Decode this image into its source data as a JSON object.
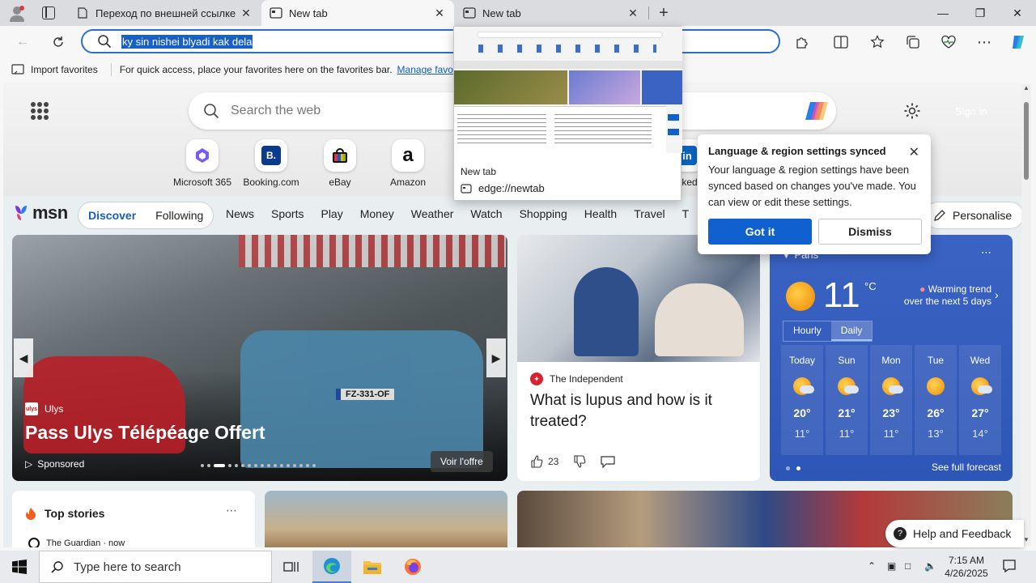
{
  "tabs": [
    {
      "title": "Переход по внешней ссылке",
      "active": false
    },
    {
      "title": "New tab",
      "active": true
    },
    {
      "title": "New tab",
      "active": false
    }
  ],
  "address_bar": {
    "text": "ky sin nishei blyadi kak dela"
  },
  "favorites_bar": {
    "import_label": "Import favorites",
    "hint": "For quick access, place your favorites here on the favorites bar.",
    "manage_link": "Manage favorites"
  },
  "newtab": {
    "search_placeholder": "Search the web",
    "sign_in": "Sign in",
    "quick_links": [
      {
        "label": "Microsoft 365",
        "icon": "microsoft-365-icon"
      },
      {
        "label": "Booking.com",
        "icon": "booking-icon",
        "glyph": "B."
      },
      {
        "label": "eBay",
        "icon": "ebay-icon"
      },
      {
        "label": "Amazon",
        "icon": "amazon-icon",
        "glyph": "a"
      },
      {
        "label": "LinkedIn",
        "icon": "linkedin-icon",
        "glyph": "in"
      }
    ]
  },
  "msn": {
    "logo": "msn",
    "feed_tabs": [
      "Discover",
      "Following"
    ],
    "nav": [
      "News",
      "Sports",
      "Play",
      "Money",
      "Weather",
      "Watch",
      "Shopping",
      "Health",
      "Travel",
      "T"
    ],
    "personalise": "Personalise"
  },
  "carousel": {
    "source": "Ulys",
    "title": "Pass Ulys Télépéage Offert",
    "sponsored": "Sponsored",
    "cta": "Voir l'offre",
    "plate": "FZ-331-OF"
  },
  "news_card": {
    "source": "The Independent",
    "title": "What is lupus and how is it treated?",
    "likes": "23"
  },
  "weather": {
    "location": "Paris",
    "temp": "11",
    "unit": "°C",
    "trend_line1": "Warming trend",
    "trend_line2": "over the next 5 days",
    "toggle": [
      "Hourly",
      "Daily"
    ],
    "days": [
      {
        "d": "Today",
        "hi": "20°",
        "lo": "11°",
        "icon": "partly-cloudy"
      },
      {
        "d": "Sun",
        "hi": "21°",
        "lo": "11°",
        "icon": "partly-cloudy"
      },
      {
        "d": "Mon",
        "hi": "23°",
        "lo": "11°",
        "icon": "partly-cloudy"
      },
      {
        "d": "Tue",
        "hi": "26°",
        "lo": "13°",
        "icon": "sunny"
      },
      {
        "d": "Wed",
        "hi": "27°",
        "lo": "14°",
        "icon": "partly-cloudy"
      }
    ],
    "see_full": "See full forecast"
  },
  "top_stories": {
    "title": "Top stories",
    "source": "The Guardian · now"
  },
  "help_feedback": "Help and Feedback",
  "tab_preview": {
    "title": "New tab",
    "url": "edge://newtab"
  },
  "lang_popup": {
    "title": "Language & region settings synced",
    "body": "Your language & region settings have been synced based on changes you've made. You can view or edit these settings.",
    "got_it": "Got it",
    "dismiss": "Dismiss"
  },
  "taskbar": {
    "search_placeholder": "Type here to search",
    "time": "7:15 AM",
    "date": "4/26/2025"
  },
  "colors": {
    "accent": "#1060d0",
    "weather_bg": "#3b63c3",
    "selection": "#1760c9"
  }
}
